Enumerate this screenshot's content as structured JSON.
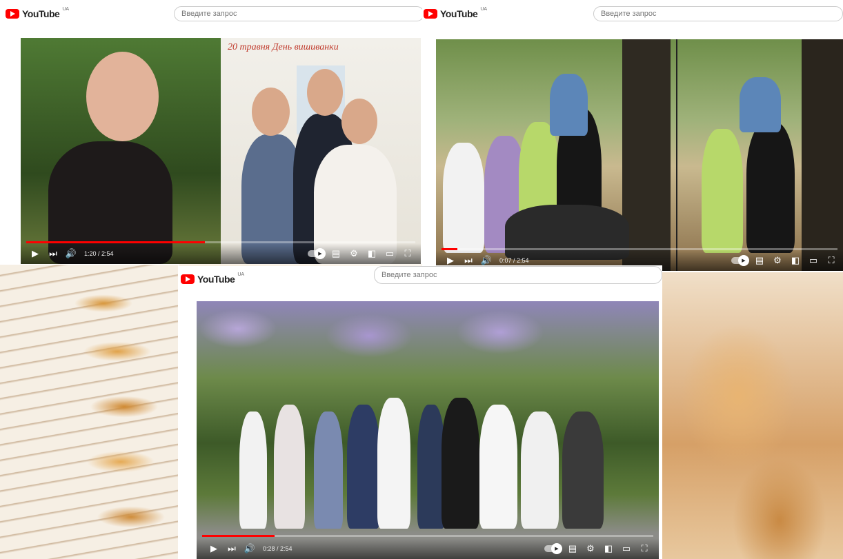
{
  "app": {
    "logo_text": "YouTube",
    "region": "UA"
  },
  "search": {
    "placeholder": "Введите запрос"
  },
  "players": [
    {
      "time": "1:20 / 2:54",
      "progress": 0.46
    },
    {
      "time": "0:07 / 2:54",
      "progress": 0.04
    },
    {
      "time": "0:28 / 2:54",
      "progress": 0.16
    }
  ],
  "banner": {
    "date_text": "20 травня День вишиванки"
  },
  "colors": {
    "brand_red": "#ff0000",
    "progress_red": "#ff0000"
  },
  "icons": [
    "play-icon",
    "next-icon",
    "volume-icon",
    "autoplay-toggle-icon",
    "subtitles-icon",
    "settings-icon",
    "miniplayer-icon",
    "theater-icon",
    "fullscreen-icon"
  ]
}
